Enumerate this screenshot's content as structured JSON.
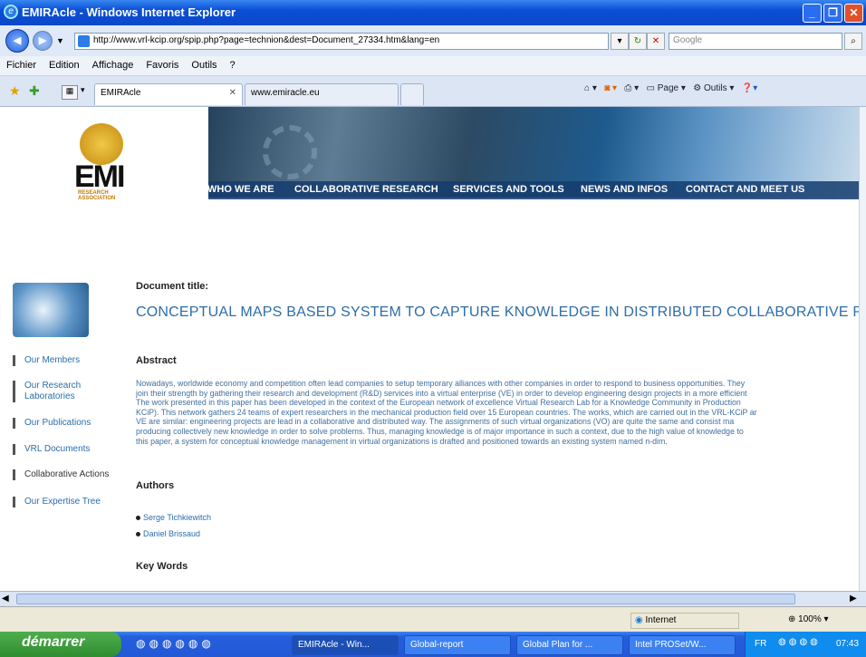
{
  "window": {
    "title": "EMIRAcle - Windows Internet Explorer"
  },
  "address": {
    "url": "http://www.vrl-kcip.org/spip.php?page=technion&dest=Document_27334.htm&lang=en",
    "search_placeholder": "Google"
  },
  "menu": [
    "Fichier",
    "Edition",
    "Affichage",
    "Favoris",
    "Outils",
    "?"
  ],
  "tabs": [
    {
      "label": "EMIRAcle"
    },
    {
      "label": "www.emiracle.eu"
    }
  ],
  "toolbar": {
    "page_label": "Page",
    "tools_label": "Outils"
  },
  "logo": {
    "text": "EMI",
    "sub": "RESEARCH ASSOCIATION"
  },
  "nav": [
    "WHO WE ARE",
    "COLLABORATIVE RESEARCH",
    "SERVICES AND TOOLS",
    "NEWS AND INFOS",
    "CONTACT AND MEET US"
  ],
  "sidebar": [
    {
      "label": "Our Members"
    },
    {
      "label": "Our Research\nLaboratories"
    },
    {
      "label": "Our Publications"
    },
    {
      "label": "VRL Documents"
    },
    {
      "label": "Collaborative Actions"
    },
    {
      "label": "Our Expertise Tree"
    }
  ],
  "doc": {
    "title_label": "Document title:",
    "title": "CONCEPTUAL MAPS BASED SYSTEM TO CAPTURE KNOWLEDGE IN DISTRIBUTED COLLABORATIVE R&D PR",
    "abstract_label": "Abstract",
    "abstract_lines": [
      "Nowadays, worldwide economy and competition often lead companies to setup temporary alliances with other companies in order to respond to business opportunities. They",
      "join their strength by gathering their research and development (R&D) services into a virtual enterprise (VE) in order to develop engineering design projects in a more efficient",
      "The work presented in this paper has been developed in the context of the European network of excellence Virtual Research Lab for a Knowledge Community in Production",
      "KCiP). This network gathers 24 teams of expert researchers in the mechanical production field over 15 European countries. The works, which are carried out in the VRL-KCiP ar",
      "VE are similar: engineering projects are lead in a collaborative and distributed way. The assignments of such virtual organizations (VO) are quite the same and consist ma",
      "producing collectively new knowledge in order to solve problems. Thus, managing knowledge is of major importance in such a context, due to the high value of knowledge to",
      "this paper, a system for conceptual knowledge management in virtual organizations is drafted and positioned towards an existing system named n-dim."
    ],
    "authors_label": "Authors",
    "authors": [
      "Serge Tichkiewitch",
      "Daniel Brissaud"
    ],
    "keywords_label": "Key Words"
  },
  "status": {
    "zone": "Internet",
    "zoom": "100%"
  },
  "taskbar": {
    "start": "démarrer",
    "tasks": [
      "EMIRAcle - Win...",
      "Global-report",
      "Global Plan for ...",
      "Intel PROSet/W..."
    ],
    "lang": "FR",
    "clock": "07:43"
  }
}
